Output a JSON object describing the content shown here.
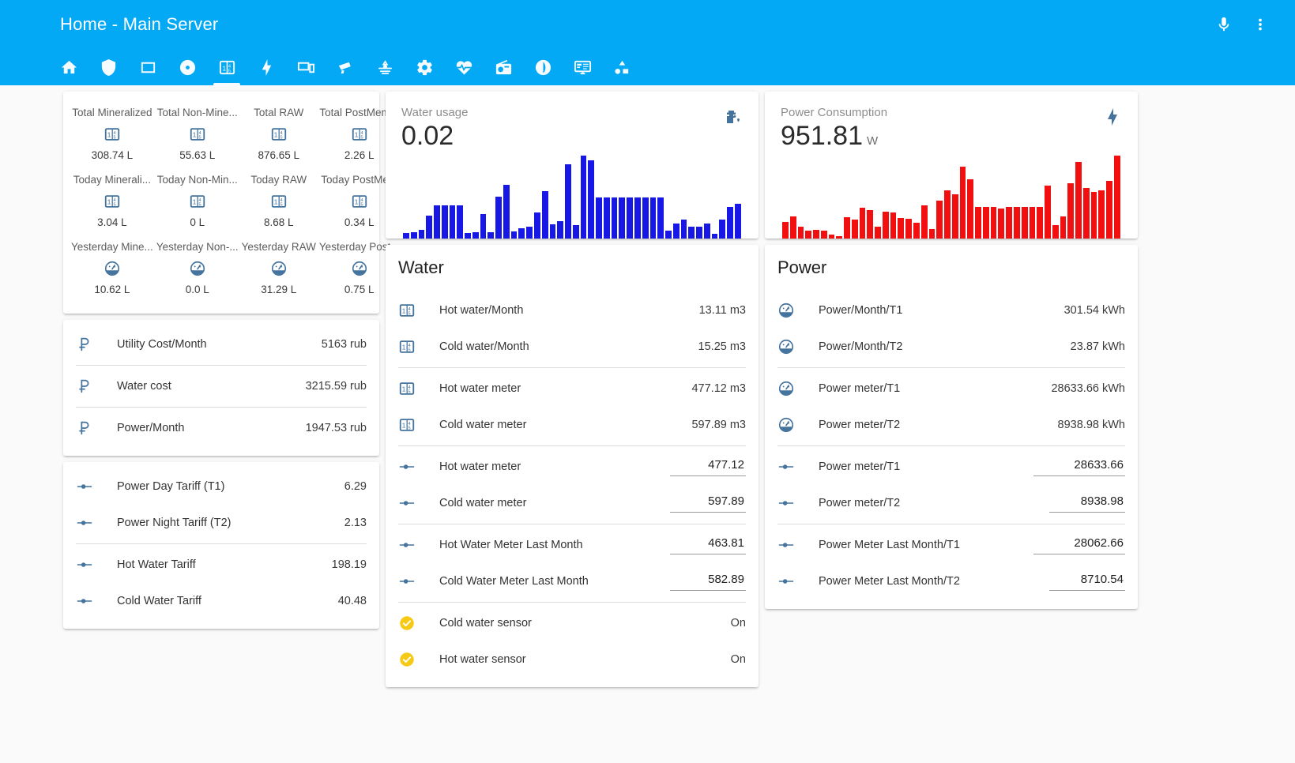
{
  "appbar": {
    "title": "Home - Main Server",
    "actions": [
      {
        "name": "assist-microphone-button",
        "icon": "microphone-icon"
      },
      {
        "name": "overflow-menu-button",
        "icon": "dots-vertical-icon"
      }
    ],
    "tabs": [
      {
        "name": "tab-home",
        "icon": "home-icon",
        "active": false
      },
      {
        "name": "tab-security",
        "icon": "shield-icon",
        "active": false
      },
      {
        "name": "tab-rooms",
        "icon": "square-outline-icon",
        "active": false
      },
      {
        "name": "tab-vacuum",
        "icon": "record-circle-icon",
        "active": false
      },
      {
        "name": "tab-meters",
        "icon": "counter-icon",
        "active": true
      },
      {
        "name": "tab-energy",
        "icon": "flash-icon",
        "active": false
      },
      {
        "name": "tab-devices",
        "icon": "devices-icon",
        "active": false
      },
      {
        "name": "tab-cameras",
        "icon": "cctv-icon",
        "active": false
      },
      {
        "name": "tab-weather",
        "icon": "weather-sunset-icon",
        "active": false
      },
      {
        "name": "tab-settings",
        "icon": "cog-icon",
        "active": false
      },
      {
        "name": "tab-health",
        "icon": "heart-pulse-icon",
        "active": false
      },
      {
        "name": "tab-media",
        "icon": "radio-icon",
        "active": false
      },
      {
        "name": "tab-network",
        "icon": "web-icon",
        "active": false
      },
      {
        "name": "tab-system",
        "icon": "monitor-dashboard-icon",
        "active": false
      },
      {
        "name": "tab-misc",
        "icon": "shapes-icon",
        "active": false
      }
    ]
  },
  "colors": {
    "accent": "#03A9F4",
    "water_bar": "#1818e6",
    "power_bar": "#f10f0f",
    "state_on": "#f6c915",
    "entity_icon": "#44739e"
  },
  "water_glance": {
    "cells": [
      {
        "name": "Total Mineralized",
        "icon": "counter-icon",
        "value": "308.74 L"
      },
      {
        "name": "Total Non-Mine...",
        "icon": "counter-icon",
        "value": "55.63 L"
      },
      {
        "name": "Total RAW",
        "icon": "counter-icon",
        "value": "876.65 L"
      },
      {
        "name": "Total PostMem...",
        "icon": "counter-icon",
        "value": "2.26 L"
      },
      {
        "name": "Today Minerali...",
        "icon": "counter-icon",
        "value": "3.04 L"
      },
      {
        "name": "Today Non-Min...",
        "icon": "counter-icon",
        "value": "0 L"
      },
      {
        "name": "Today RAW",
        "icon": "counter-icon",
        "value": "8.68 L"
      },
      {
        "name": "Today PostMe...",
        "icon": "counter-icon",
        "value": "0.34 L"
      },
      {
        "name": "Yesterday Mine...",
        "icon": "gauge-icon",
        "value": "10.62 L"
      },
      {
        "name": "Yesterday Non-...",
        "icon": "gauge-icon",
        "value": "0.0 L"
      },
      {
        "name": "Yesterday RAW",
        "icon": "gauge-icon",
        "value": "31.29 L"
      },
      {
        "name": "Yesterday Post...",
        "icon": "gauge-icon",
        "value": "0.75 L"
      }
    ]
  },
  "cost_card": {
    "rows": [
      {
        "icon": "currency-rub-icon",
        "label": "Utility Cost/Month",
        "value": "5163 rub"
      },
      {
        "icon": "currency-rub-icon",
        "label": "Water cost",
        "value": "3215.59 rub"
      },
      {
        "icon": "currency-rub-icon",
        "label": "Power/Month",
        "value": "1947.53 rub"
      }
    ]
  },
  "tariff_card": {
    "rows": [
      {
        "icon": "ray-vertex-icon",
        "label": "Power Day Tariff (T1)",
        "value": "6.29"
      },
      {
        "icon": "ray-vertex-icon",
        "label": "Power Night Tariff (T2)",
        "value": "2.13"
      },
      {
        "icon": "ray-vertex-icon",
        "label": "Hot Water Tariff",
        "value": "198.19"
      },
      {
        "icon": "ray-vertex-icon",
        "label": "Cold Water Tariff",
        "value": "40.48"
      }
    ]
  },
  "water_sensor": {
    "name": "Water usage",
    "state": "0.02",
    "unit": "",
    "icon": "water-pump-icon"
  },
  "power_sensor": {
    "name": "Power Consumption",
    "state": "951.81",
    "unit": "W",
    "icon": "flash-icon"
  },
  "water_card": {
    "title": "Water",
    "rows": [
      {
        "icon": "counter-icon",
        "label": "Hot water/Month",
        "value": "13.11 m3",
        "type": "text"
      },
      {
        "icon": "counter-icon",
        "label": "Cold water/Month",
        "value": "15.25 m3",
        "type": "text"
      },
      {
        "icon": "counter-icon",
        "label": "Hot water meter",
        "value": "477.12 m3",
        "type": "text"
      },
      {
        "icon": "counter-icon",
        "label": "Cold water meter",
        "value": "597.89 m3",
        "type": "text"
      },
      {
        "icon": "ray-vertex-icon",
        "label": "Hot water meter",
        "value": "477.12",
        "type": "input"
      },
      {
        "icon": "ray-vertex-icon",
        "label": "Cold water meter",
        "value": "597.89",
        "type": "input"
      },
      {
        "icon": "ray-vertex-icon",
        "label": "Hot Water Meter Last Month",
        "value": "463.81",
        "type": "input"
      },
      {
        "icon": "ray-vertex-icon",
        "label": "Cold Water Meter Last Month",
        "value": "582.89",
        "type": "input"
      },
      {
        "icon": "check-circle-icon",
        "label": "Cold water sensor",
        "value": "On",
        "type": "text"
      },
      {
        "icon": "check-circle-icon",
        "label": "Hot water sensor",
        "value": "On",
        "type": "text"
      }
    ]
  },
  "power_card": {
    "title": "Power",
    "rows": [
      {
        "icon": "gauge-icon",
        "label": "Power/Month/T1",
        "value": "301.54 kWh",
        "type": "text"
      },
      {
        "icon": "gauge-icon",
        "label": "Power/Month/T2",
        "value": "23.87 kWh",
        "type": "text"
      },
      {
        "icon": "gauge-icon",
        "label": "Power meter/T1",
        "value": "28633.66 kWh",
        "type": "text"
      },
      {
        "icon": "gauge-icon",
        "label": "Power meter/T2",
        "value": "8938.98 kWh",
        "type": "text"
      },
      {
        "icon": "ray-vertex-icon",
        "label": "Power meter/T1",
        "value": "28633.66",
        "type": "input"
      },
      {
        "icon": "ray-vertex-icon",
        "label": "Power meter/T2",
        "value": "8938.98",
        "type": "input"
      },
      {
        "icon": "ray-vertex-icon",
        "label": "Power Meter Last Month/T1",
        "value": "28062.66",
        "type": "input"
      },
      {
        "icon": "ray-vertex-icon",
        "label": "Power Meter Last Month/T2",
        "value": "8710.54",
        "type": "input"
      }
    ]
  },
  "chart_data": [
    {
      "type": "bar",
      "title": "Water usage",
      "xlabel": "",
      "ylabel": "",
      "color": "#1818e6",
      "ylim": [
        0,
        100
      ],
      "grid": false,
      "legend": "none",
      "values": [
        6,
        7,
        10,
        26,
        38,
        38,
        38,
        38,
        6,
        7,
        28,
        7,
        48,
        62,
        8,
        12,
        13,
        30,
        55,
        16,
        20,
        86,
        15,
        96,
        90,
        47,
        47,
        47,
        47,
        47,
        47,
        47,
        47,
        47,
        9,
        17,
        22,
        13,
        13,
        17,
        5,
        22,
        36,
        40
      ]
    },
    {
      "type": "bar",
      "title": "Power Consumption",
      "xlabel": "",
      "ylabel": "",
      "color": "#f10f0f",
      "ylim": [
        0,
        100
      ],
      "grid": false,
      "legend": "none",
      "values": [
        18,
        24,
        13,
        8,
        9,
        8,
        4,
        2,
        23,
        20,
        33,
        31,
        13,
        29,
        28,
        22,
        21,
        17,
        36,
        10,
        41,
        52,
        48,
        78,
        64,
        34,
        34,
        34,
        32,
        34,
        34,
        34,
        34,
        34,
        57,
        14,
        24,
        60,
        83,
        55,
        50,
        52,
        62,
        90
      ]
    }
  ]
}
